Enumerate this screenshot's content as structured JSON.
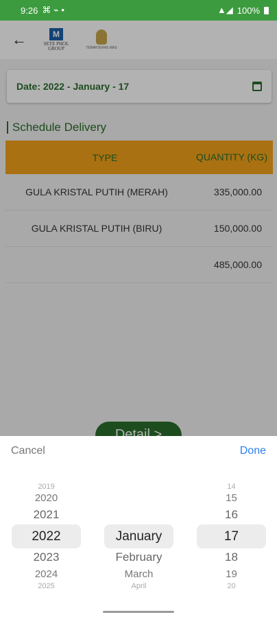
{
  "status_bar": {
    "time": "9:26",
    "battery": "100%"
  },
  "header": {
    "logo_primary": "SETE PHOL GROUP",
    "logo_secondary": "TEBARTERAS MAS"
  },
  "filter": {
    "date_label": "Date: 2022 - January - 17"
  },
  "section": {
    "title": "Schedule Delivery"
  },
  "table": {
    "headers": {
      "type": "TYPE",
      "quantity": "QUANTITY (KG)"
    },
    "rows": [
      {
        "type": "GULA KRISTAL PUTIH (MERAH)",
        "quantity": "335,000.00"
      },
      {
        "type": "GULA KRISTAL PUTIH (BIRU)",
        "quantity": "150,000.00"
      },
      {
        "type": "",
        "quantity": "485,000.00"
      }
    ]
  },
  "detail_button": {
    "label": "Detail >"
  },
  "date_picker": {
    "cancel_label": "Cancel",
    "done_label": "Done",
    "years": [
      "2019",
      "2020",
      "2021",
      "2022",
      "2023",
      "2024",
      "2025"
    ],
    "months": [
      "January",
      "February",
      "March",
      "April"
    ],
    "days": [
      "14",
      "15",
      "16",
      "17",
      "18",
      "19",
      "20"
    ],
    "selected": {
      "year": "2022",
      "month": "January",
      "day": "17"
    }
  },
  "colors": {
    "brand_green": "#2a6e2c",
    "status_green": "#3d9b3f",
    "header_orange": "#f2a31a",
    "done_blue": "#2f80ed"
  }
}
